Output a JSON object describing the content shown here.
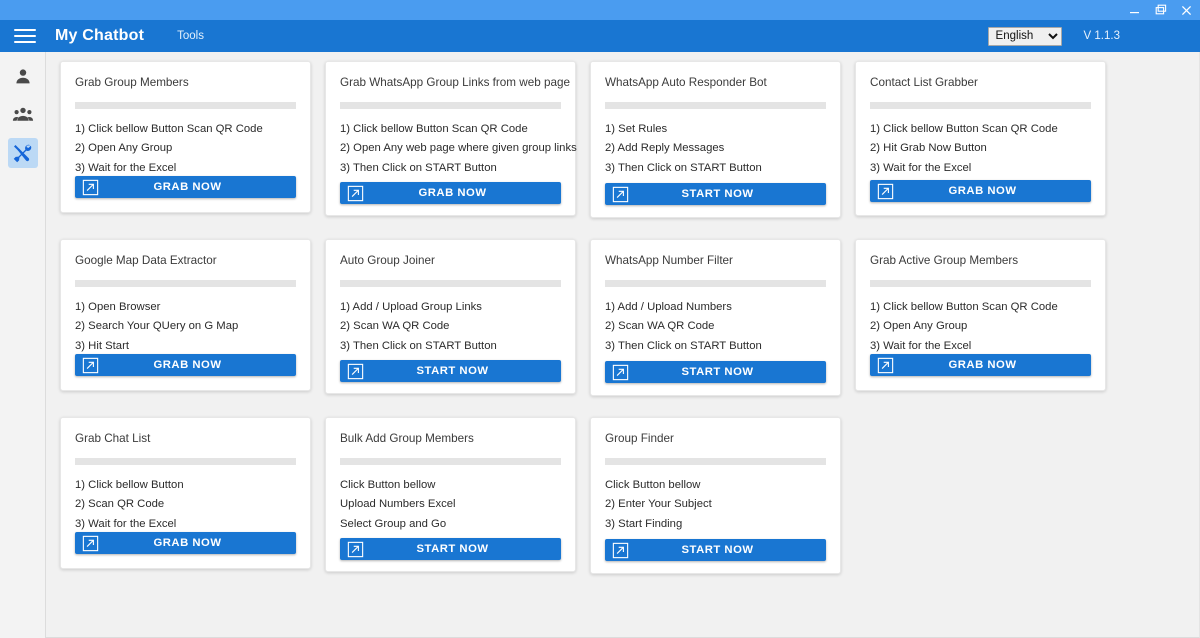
{
  "window": {
    "controls": [
      {
        "name": "minimize-button",
        "glyph": "minimize"
      },
      {
        "name": "restore-button",
        "glyph": "restore"
      },
      {
        "name": "close-button",
        "glyph": "close"
      }
    ]
  },
  "appbar": {
    "menu_icon": "hamburger-menu-icon",
    "title": "My Chatbot",
    "nav": [
      {
        "label": "Tools"
      }
    ],
    "language": {
      "selected": "English",
      "options": [
        "English"
      ]
    },
    "version": "V 1.1.3"
  },
  "sidebar": {
    "items": [
      {
        "name": "sidebar-item-profile",
        "icon": "person-icon",
        "active": false
      },
      {
        "name": "sidebar-item-groups",
        "icon": "people-group-icon",
        "active": false
      },
      {
        "name": "sidebar-item-tools",
        "icon": "tools-icon",
        "active": true
      }
    ]
  },
  "theme": {
    "accent": "#1976d2",
    "titlebar": "#4a9cf0",
    "page_bg": "#f1f1f1",
    "card_bg": "#ffffff",
    "divider": "#e4e4e4",
    "rail_active": "#bcd9f5"
  },
  "main": {
    "cards": [
      {
        "title": "Grab Group Members",
        "steps": [
          "1) Click bellow Button Scan QR Code",
          "2) Open Any Group",
          "3) Wait for the Excel"
        ],
        "button": {
          "label": "GRAB NOW",
          "icon": "external-link-icon"
        },
        "size": "h1"
      },
      {
        "title": "Grab WhatsApp Group Links from web page",
        "steps": [
          "1) Click bellow Button Scan QR Code",
          "2) Open Any web page where given group links",
          "3) Then Click on START Button"
        ],
        "button": {
          "label": "GRAB NOW",
          "icon": "external-link-icon"
        },
        "size": "h2"
      },
      {
        "title": "WhatsApp Auto Responder Bot",
        "steps": [
          "1) Set Rules",
          "2) Add Reply Messages",
          "3) Then Click on START Button"
        ],
        "button": {
          "label": "START NOW",
          "icon": "external-link-icon"
        },
        "size": "h3"
      },
      {
        "title": "Contact List Grabber",
        "steps": [
          "1) Click bellow Button Scan QR Code",
          "2) Hit Grab Now Button",
          "3) Wait for the Excel"
        ],
        "button": {
          "label": "GRAB NOW",
          "icon": "external-link-icon"
        },
        "size": "h4"
      },
      {
        "title": "Google Map Data Extractor",
        "steps": [
          "1) Open Browser",
          "2) Search Your QUery on G Map",
          "3) Hit Start"
        ],
        "button": {
          "label": "GRAB NOW",
          "icon": "external-link-icon"
        },
        "size": "h1"
      },
      {
        "title": "Auto Group Joiner",
        "steps": [
          "1) Add / Upload Group Links",
          "2) Scan WA QR Code",
          "3) Then Click on START Button"
        ],
        "button": {
          "label": "START NOW",
          "icon": "external-link-icon"
        },
        "size": "h2"
      },
      {
        "title": "WhatsApp Number Filter",
        "steps": [
          "1) Add / Upload Numbers",
          "2) Scan WA QR Code",
          "3) Then Click on START Button"
        ],
        "button": {
          "label": "START NOW",
          "icon": "external-link-icon"
        },
        "size": "h3"
      },
      {
        "title": "Grab Active Group Members",
        "steps": [
          "1) Click bellow Button Scan QR Code",
          "2) Open Any Group",
          "3) Wait for the Excel"
        ],
        "button": {
          "label": "GRAB NOW",
          "icon": "external-link-icon"
        },
        "size": "h1"
      },
      {
        "title": "Grab Chat List",
        "steps": [
          "1) Click bellow Button",
          "2) Scan QR Code",
          "3) Wait for the Excel"
        ],
        "button": {
          "label": "GRAB NOW",
          "icon": "external-link-icon"
        },
        "size": "h1"
      },
      {
        "title": "Bulk Add Group Members",
        "steps": [
          "Click Button bellow",
          "Upload Numbers Excel",
          "Select Group and Go"
        ],
        "button": {
          "label": "START NOW",
          "icon": "external-link-icon"
        },
        "size": "h2"
      },
      {
        "title": "Group Finder",
        "steps": [
          "Click Button bellow",
          "2) Enter Your Subject",
          "3) Start Finding"
        ],
        "button": {
          "label": "START NOW",
          "icon": "external-link-icon"
        },
        "size": "h3"
      }
    ]
  }
}
